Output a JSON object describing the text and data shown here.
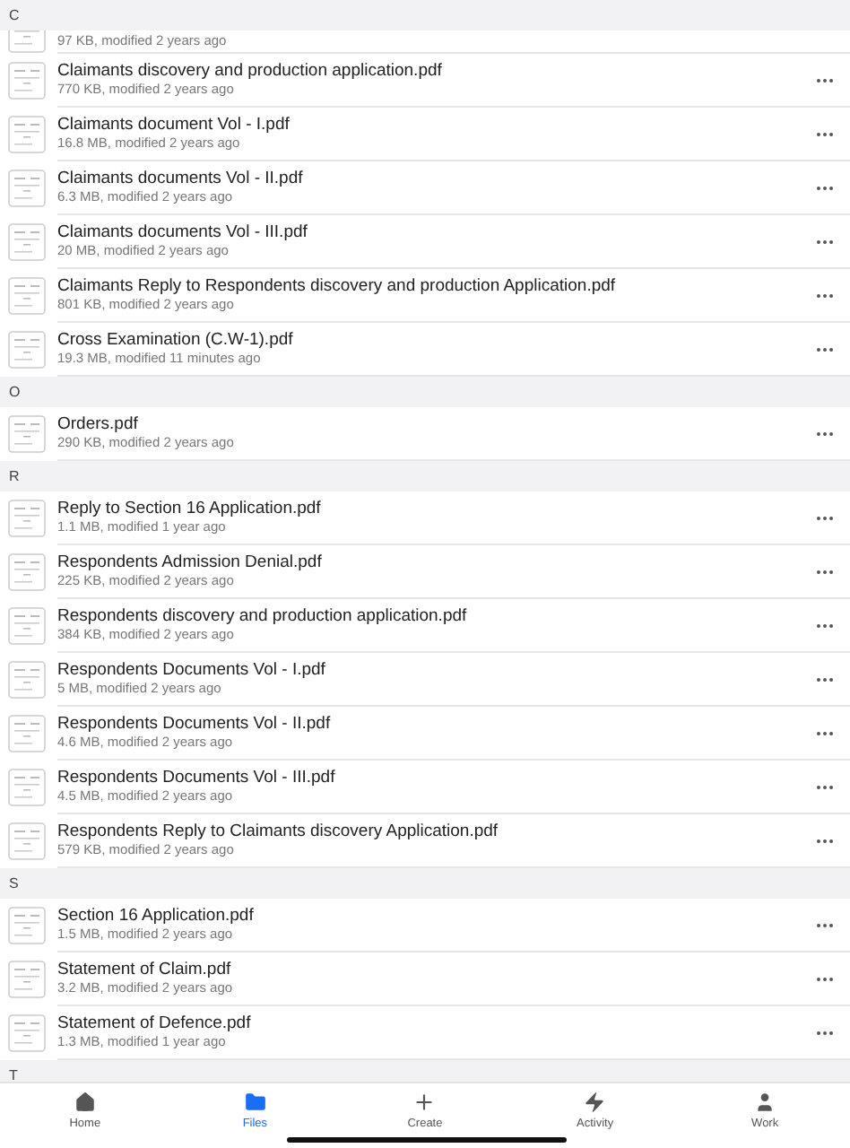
{
  "sections": [
    {
      "letter": "C",
      "files": [
        {
          "meta": "97 KB, modified 2 years ago",
          "partial": true
        },
        {
          "name": "Claimants discovery and production application.pdf",
          "meta": "770 KB, modified 2 years ago"
        },
        {
          "name": "Claimants document Vol - I.pdf",
          "meta": "16.8 MB, modified 2 years ago"
        },
        {
          "name": "Claimants documents Vol - II.pdf",
          "meta": "6.3 MB, modified 2 years ago"
        },
        {
          "name": "Claimants documents Vol - III.pdf",
          "meta": "20 MB, modified 2 years ago"
        },
        {
          "name": "Claimants Reply to Respondents discovery and production Application.pdf",
          "meta": "801 KB, modified 2 years ago"
        },
        {
          "name": "Cross Examination (C.W-1).pdf",
          "meta": "19.3 MB, modified 11 minutes ago"
        }
      ]
    },
    {
      "letter": "O",
      "files": [
        {
          "name": "Orders.pdf",
          "meta": "290 KB, modified 2 years ago"
        }
      ]
    },
    {
      "letter": "R",
      "files": [
        {
          "name": "Reply to Section 16 Application.pdf",
          "meta": "1.1 MB, modified 1 year ago"
        },
        {
          "name": "Respondents Admission Denial.pdf",
          "meta": "225 KB, modified 2 years ago"
        },
        {
          "name": "Respondents discovery and production application.pdf",
          "meta": "384 KB, modified 2 years ago"
        },
        {
          "name": "Respondents Documents Vol - I.pdf",
          "meta": "5 MB, modified 2 years ago"
        },
        {
          "name": "Respondents Documents Vol - II.pdf",
          "meta": "4.6 MB, modified 2 years ago"
        },
        {
          "name": "Respondents Documents Vol - III.pdf",
          "meta": "4.5 MB, modified 2 years ago"
        },
        {
          "name": "Respondents Reply to Claimants discovery Application.pdf",
          "meta": "579 KB, modified 2 years ago"
        }
      ]
    },
    {
      "letter": "S",
      "files": [
        {
          "name": "Section 16 Application.pdf",
          "meta": "1.5 MB, modified 2 years ago"
        },
        {
          "name": "Statement of Claim.pdf",
          "meta": "3.2 MB, modified 2 years ago"
        },
        {
          "name": "Statement of Defence.pdf",
          "meta": "1.3 MB, modified 1 year ago"
        }
      ]
    },
    {
      "letter": "T"
    }
  ],
  "tabs": [
    {
      "label": "Home",
      "kind": "home",
      "selected": false
    },
    {
      "label": "Files",
      "kind": "files",
      "selected": true
    },
    {
      "label": "Create",
      "kind": "create",
      "selected": false
    },
    {
      "label": "Activity",
      "kind": "activity",
      "selected": false
    },
    {
      "label": "Work",
      "kind": "work",
      "selected": false
    }
  ]
}
